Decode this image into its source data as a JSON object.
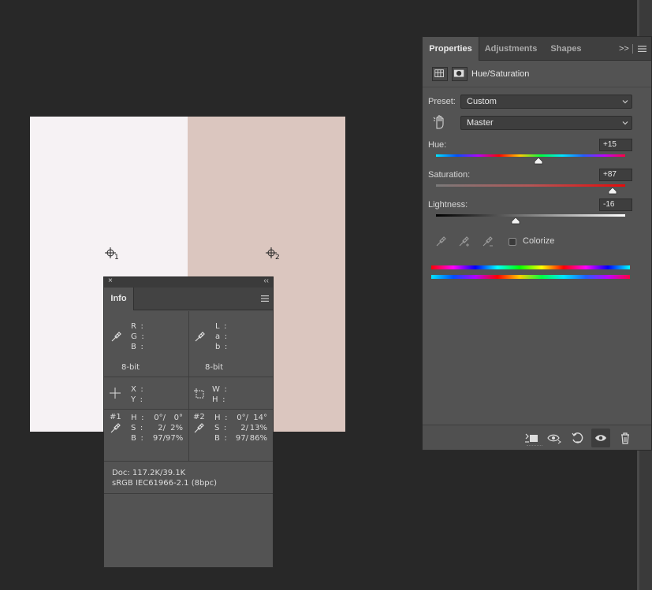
{
  "canvas": {
    "swatch_left_color": "#f6f2f4",
    "swatch_right_color": "#dbc6bf",
    "samplers": [
      {
        "number": "1"
      },
      {
        "number": "2"
      }
    ]
  },
  "info_panel": {
    "tab_label": "Info",
    "close_glyph": "×",
    "collapse_glyph": "‹‹",
    "rgb": {
      "labels": "R :\nG :\nB :",
      "bit_depth": "8-bit"
    },
    "lab": {
      "labels": "L :\na :\nb :",
      "bit_depth": "8-bit"
    },
    "xy": {
      "labels": "X :\nY :"
    },
    "wh": {
      "labels": "W :\nH :"
    },
    "sampler1": {
      "id": "#1",
      "labels": "H :\nS :\nB :",
      "col1": "0°/\n2/\n97/",
      "col2": "0°\n2%\n97%"
    },
    "sampler2": {
      "id": "#2",
      "labels": "H :\nS :\nB :",
      "col1": "0°/\n2/\n97/",
      "col2": "14°\n13%\n86%"
    },
    "doc_line": "Doc: 117.2K/39.1K",
    "profile_line": "sRGB IEC61966-2.1 (8bpc)"
  },
  "properties_panel": {
    "tabs": [
      "Properties",
      "Adjustments",
      "Shapes"
    ],
    "more_glyph": ">>",
    "adjustment_title": "Hue/Saturation",
    "preset_label": "Preset:",
    "preset_value": "Custom",
    "channel_value": "Master",
    "hue": {
      "label": "Hue:",
      "value": "+15",
      "amount": 15,
      "min": -180,
      "max": 180
    },
    "saturation": {
      "label": "Saturation:",
      "value": "+87",
      "amount": 87,
      "min": -100,
      "max": 100
    },
    "lightness": {
      "label": "Lightness:",
      "value": "-16",
      "amount": -16,
      "min": -100,
      "max": 100
    },
    "colorize_label": "Colorize",
    "colorize_checked": false
  },
  "colors": {
    "panel_bg": "#535353",
    "app_bg": "#282828",
    "accent_text": "#ebebeb"
  }
}
